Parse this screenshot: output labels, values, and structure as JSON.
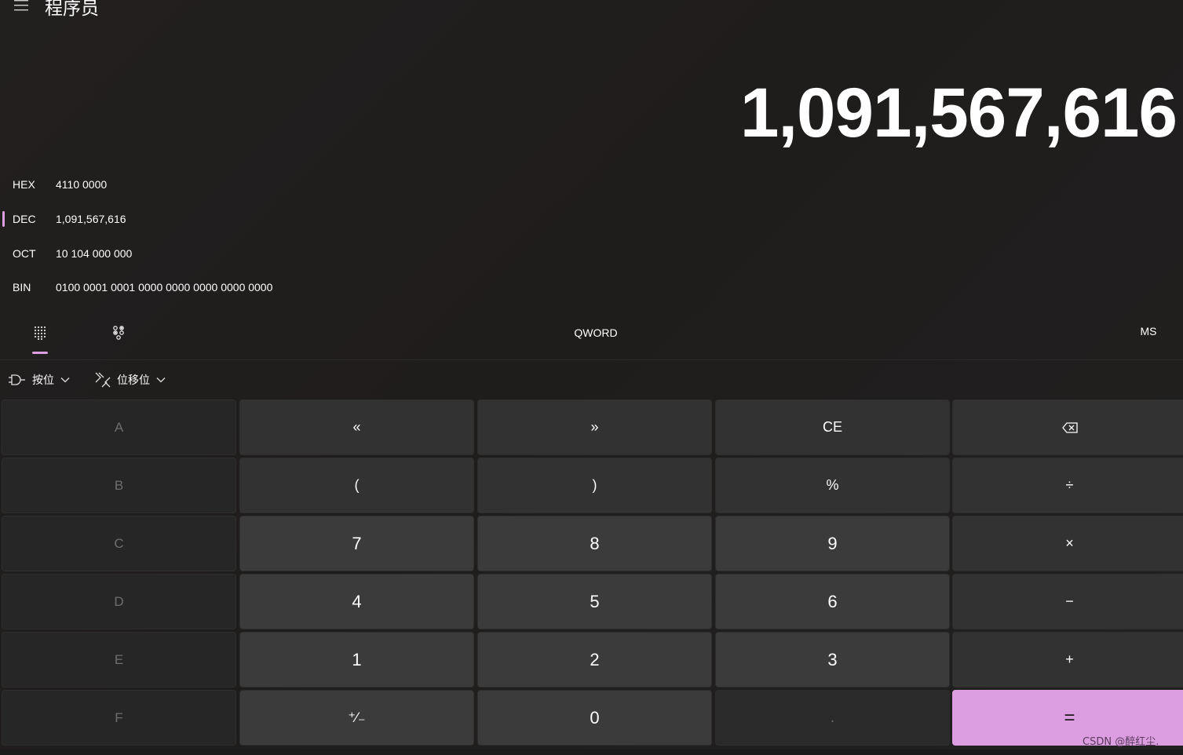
{
  "header": {
    "title": "程序员",
    "menu_icon": "hamburger-icon"
  },
  "display": {
    "value": "1,091,567,616"
  },
  "radix": [
    {
      "name": "HEX",
      "value": "4110 0000",
      "selected": false
    },
    {
      "name": "DEC",
      "value": "1,091,567,616",
      "selected": true
    },
    {
      "name": "OCT",
      "value": "10 104 000 000",
      "selected": false
    },
    {
      "name": "BIN",
      "value": "0100 0001 0001 0000 0000 0000 0000 0000",
      "selected": false
    }
  ],
  "mode_bar": {
    "full_keypad_icon": "keypad-grid-icon",
    "bit_toggle_icon": "bit-toggle-icon",
    "word_size": "QWORD",
    "memory_store": "MS"
  },
  "functions": {
    "bitwise_label": "按位",
    "bitshift_label": "位移位"
  },
  "keys": {
    "hex_a": "A",
    "lshift": "«",
    "rshift": "»",
    "ce": "CE",
    "backspace_icon": "backspace-icon",
    "hex_b": "B",
    "lparen": "(",
    "rparen": ")",
    "percent": "%",
    "divide": "÷",
    "hex_c": "C",
    "seven": "7",
    "eight": "8",
    "nine": "9",
    "multiply": "×",
    "hex_d": "D",
    "four": "4",
    "five": "5",
    "six": "6",
    "minus": "−",
    "hex_e": "E",
    "one": "1",
    "two": "2",
    "three": "3",
    "plus": "+",
    "hex_f": "F",
    "negate": "⁺∕₋",
    "zero": "0",
    "decimal": ".",
    "equals": "="
  },
  "colors": {
    "accent": "#dc9ee0",
    "background": "#202020",
    "number_key": "#3b3b3b",
    "operator_key": "#323232",
    "hex_key": "#262626"
  },
  "watermark": "CSDN @醉红尘."
}
